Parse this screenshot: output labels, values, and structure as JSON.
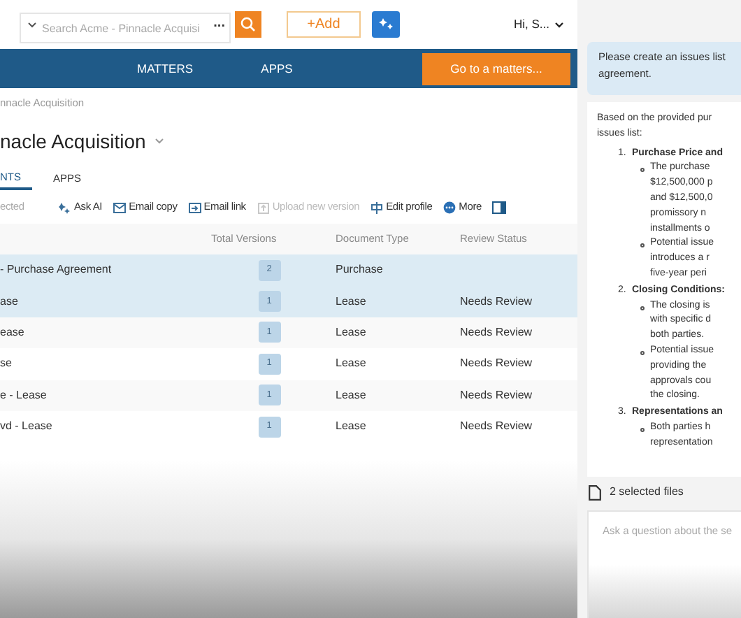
{
  "header": {
    "search": {
      "placeholder": "Search Acme - Pinnacle Acquisi",
      "more": "..."
    },
    "add_button": "+Add",
    "user": "Hi, S..."
  },
  "nav": {
    "items": [
      "MATTERS",
      "APPS"
    ],
    "goto_button": "Go to a matters..."
  },
  "breadcrumb": "nnacle Acquisition",
  "title": "nacle Acquisition",
  "tabs": [
    {
      "label": "NTS",
      "selected": true
    },
    {
      "label": "APPS",
      "selected": false
    }
  ],
  "toolbar": {
    "selection": "ected",
    "actions": [
      {
        "kind": "sparkle",
        "label": "Ask AI",
        "disabled": false
      },
      {
        "kind": "mail",
        "label": "Email copy",
        "disabled": false
      },
      {
        "kind": "link",
        "label": "Email link",
        "disabled": false
      },
      {
        "kind": "upload",
        "label": "Upload new version",
        "disabled": true
      },
      {
        "kind": "edit",
        "label": "Edit profile",
        "disabled": false
      },
      {
        "kind": "more",
        "label": "More",
        "disabled": false
      }
    ]
  },
  "table": {
    "columns": [
      "Total Versions",
      "Document Type",
      "Review Status"
    ],
    "rows": [
      {
        "name": "- Purchase Agreement",
        "versions": "2",
        "type": "Purchase",
        "status": "",
        "selected": true
      },
      {
        "name": "ase",
        "versions": "1",
        "type": "Lease",
        "status": "Needs Review",
        "selected": true
      },
      {
        "name": "ease",
        "versions": "1",
        "type": "Lease",
        "status": "Needs Review",
        "selected": false
      },
      {
        "name": "se",
        "versions": "1",
        "type": "Lease",
        "status": "Needs Review",
        "selected": false
      },
      {
        "name": "e - Lease",
        "versions": "1",
        "type": "Lease",
        "status": "Needs Review",
        "selected": false
      },
      {
        "name": "vd - Lease",
        "versions": "1",
        "type": "Lease",
        "status": "Needs Review",
        "selected": false
      }
    ]
  },
  "chat": {
    "question_lines": [
      "Please create an issues list",
      "agreement."
    ],
    "answer_intro": [
      "Based on the provided pur",
      "issues list:"
    ],
    "answer_items": [
      {
        "number": "1.",
        "title": "Purchase Price and",
        "bullets": [
          [
            "The purchase",
            "$12,500,000 p",
            "and $12,500,0",
            "promissory n",
            "installments o"
          ],
          [
            "Potential issue",
            "introduces a r",
            "five-year peri"
          ]
        ]
      },
      {
        "number": "2.",
        "title": "Closing Conditions:",
        "bullets": [
          [
            "The closing is",
            "with specific d",
            "both parties."
          ],
          [
            "Potential issue",
            "providing the",
            "approvals cou",
            "the closing."
          ]
        ]
      },
      {
        "number": "3.",
        "title": "Representations an",
        "bullets": [
          [
            "Both parties h",
            "representation"
          ]
        ]
      }
    ],
    "selected_files": "2 selected files",
    "input": {
      "placeholder": "Ask a question about the se"
    }
  }
}
